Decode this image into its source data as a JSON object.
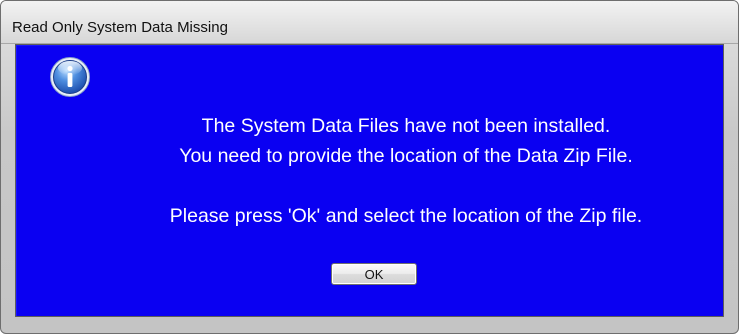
{
  "window": {
    "title": "Read Only System Data Missing"
  },
  "dialog": {
    "icon": "information-icon",
    "message_line_1": "The System Data Files have not been installed.",
    "message_line_2": "You need to provide the location of the Data Zip File.",
    "message_line_3": "Please press 'Ok' and select the location of the Zip file.",
    "ok_label": "OK"
  },
  "colors": {
    "background": "#0a00f2",
    "text": "#ffffff"
  }
}
